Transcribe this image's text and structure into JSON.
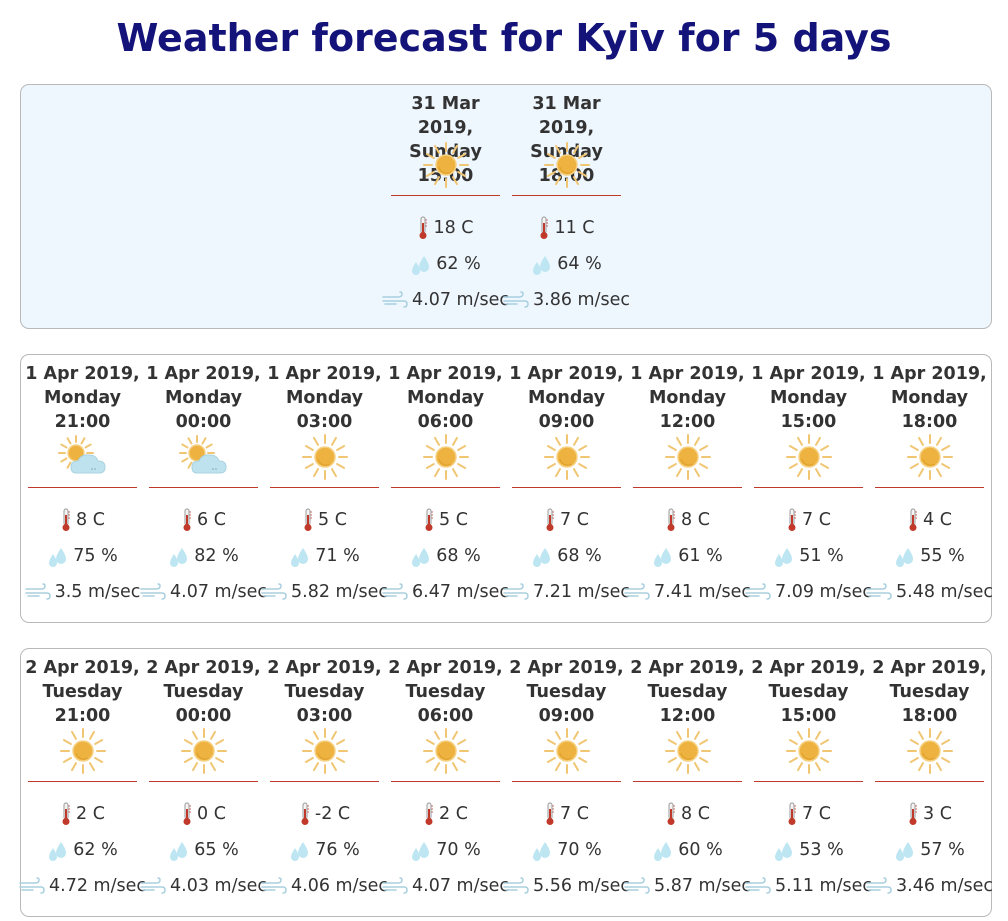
{
  "page": {
    "title": "Weather forecast for Kyiv for 5 days"
  },
  "colors": {
    "title": "#13137a",
    "divider": "#c0392b",
    "today_bg": "#eef6fe",
    "border": "#b9b9b9"
  },
  "days": [
    {
      "id": "day-2019-03-31",
      "slots": [
        {
          "datetime": "31 Mar 2019,\nSunday 15:00",
          "icon": "sun-icon",
          "temperature": "18 C",
          "humidity": "62 %",
          "wind": "4.07 m/sec"
        },
        {
          "datetime": "31 Mar 2019,\nSunday 18:00",
          "icon": "sun-icon",
          "temperature": "11 C",
          "humidity": "64 %",
          "wind": "3.86 m/sec"
        }
      ]
    },
    {
      "id": "day-2019-04-01",
      "slots": [
        {
          "datetime": "1 Apr 2019,\nMonday\n21:00",
          "icon": "partly-cloudy-icon",
          "temperature": "8 C",
          "humidity": "75 %",
          "wind": "3.5 m/sec"
        },
        {
          "datetime": "1 Apr 2019,\nMonday\n00:00",
          "icon": "partly-cloudy-icon",
          "temperature": "6 C",
          "humidity": "82 %",
          "wind": "4.07 m/sec"
        },
        {
          "datetime": "1 Apr 2019,\nMonday\n03:00",
          "icon": "sun-icon",
          "temperature": "5 C",
          "humidity": "71 %",
          "wind": "5.82 m/sec"
        },
        {
          "datetime": "1 Apr 2019,\nMonday\n06:00",
          "icon": "sun-icon",
          "temperature": "5 C",
          "humidity": "68 %",
          "wind": "6.47 m/sec"
        },
        {
          "datetime": "1 Apr 2019,\nMonday\n09:00",
          "icon": "sun-icon",
          "temperature": "7 C",
          "humidity": "68 %",
          "wind": "7.21 m/sec"
        },
        {
          "datetime": "1 Apr 2019,\nMonday\n12:00",
          "icon": "sun-icon",
          "temperature": "8 C",
          "humidity": "61 %",
          "wind": "7.41 m/sec"
        },
        {
          "datetime": "1 Apr 2019,\nMonday\n15:00",
          "icon": "sun-icon",
          "temperature": "7 C",
          "humidity": "51 %",
          "wind": "7.09 m/sec"
        },
        {
          "datetime": "1 Apr 2019,\nMonday\n18:00",
          "icon": "sun-icon",
          "temperature": "4 C",
          "humidity": "55 %",
          "wind": "5.48 m/sec"
        }
      ]
    },
    {
      "id": "day-2019-04-02",
      "slots": [
        {
          "datetime": "2 Apr 2019,\nTuesday\n21:00",
          "icon": "sun-icon",
          "temperature": "2 C",
          "humidity": "62 %",
          "wind": "4.72 m/sec"
        },
        {
          "datetime": "2 Apr 2019,\nTuesday\n00:00",
          "icon": "sun-icon",
          "temperature": "0 C",
          "humidity": "65 %",
          "wind": "4.03 m/sec"
        },
        {
          "datetime": "2 Apr 2019,\nTuesday\n03:00",
          "icon": "sun-icon",
          "temperature": "-2 C",
          "humidity": "76 %",
          "wind": "4.06 m/sec"
        },
        {
          "datetime": "2 Apr 2019,\nTuesday\n06:00",
          "icon": "sun-icon",
          "temperature": "2 C",
          "humidity": "70 %",
          "wind": "4.07 m/sec"
        },
        {
          "datetime": "2 Apr 2019,\nTuesday\n09:00",
          "icon": "sun-icon",
          "temperature": "7 C",
          "humidity": "70 %",
          "wind": "5.56 m/sec"
        },
        {
          "datetime": "2 Apr 2019,\nTuesday\n12:00",
          "icon": "sun-icon",
          "temperature": "8 C",
          "humidity": "60 %",
          "wind": "5.87 m/sec"
        },
        {
          "datetime": "2 Apr 2019,\nTuesday\n15:00",
          "icon": "sun-icon",
          "temperature": "7 C",
          "humidity": "53 %",
          "wind": "5.11 m/sec"
        },
        {
          "datetime": "2 Apr 2019,\nTuesday\n18:00",
          "icon": "sun-icon",
          "temperature": "3 C",
          "humidity": "57 %",
          "wind": "3.46 m/sec"
        }
      ]
    }
  ]
}
